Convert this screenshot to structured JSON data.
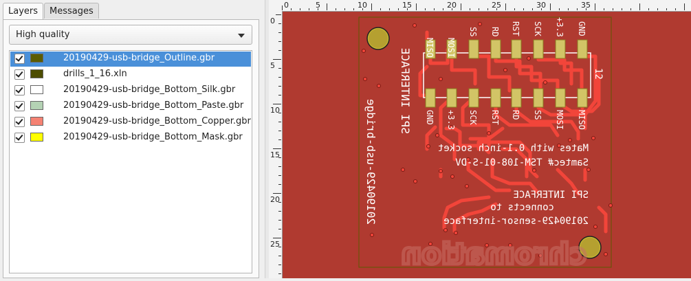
{
  "tabs": [
    {
      "label": "Layers",
      "active": true
    },
    {
      "label": "Messages",
      "active": false
    }
  ],
  "quality": {
    "selected": "High quality"
  },
  "layers": [
    {
      "name": "20190429-usb-bridge_Outline.gbr",
      "color": "#5b5b00",
      "checked": true,
      "selected": true
    },
    {
      "name": "drills_1_16.xln",
      "color": "#4d4d00",
      "checked": true,
      "selected": false
    },
    {
      "name": "20190429-usb-bridge_Bottom_Silk.gbr",
      "color": "#ffffff",
      "checked": true,
      "selected": false
    },
    {
      "name": "20190429-usb-bridge_Bottom_Paste.gbr",
      "color": "#b4d2b4",
      "checked": true,
      "selected": false
    },
    {
      "name": "20190429-usb-bridge_Bottom_Copper.gbr",
      "color": "#f58273",
      "checked": true,
      "selected": false
    },
    {
      "name": "20190429-usb-bridge_Bottom_Mask.gbr",
      "color": "#ffff00",
      "checked": true,
      "selected": false
    }
  ],
  "ruler": {
    "top_labels": [
      "0",
      "5",
      "10",
      "15",
      "20",
      "25",
      "30",
      "35"
    ],
    "left_labels": [
      "0",
      "5",
      "10",
      "15",
      "20",
      "25"
    ]
  },
  "board": {
    "pins_top": [
      "MISO",
      "MOSI",
      "SS",
      "RD",
      "RST",
      "SCK",
      "+3.3",
      "GND"
    ],
    "pins_bottom": [
      "GND",
      "+3.3",
      "SCK",
      "RST",
      "RD",
      "SS",
      "MOSI",
      "MISO"
    ],
    "title_vertical": "SPI INTERFACE",
    "date_vertical": "20190429-usb-bridge",
    "pin_count": "12",
    "notes": [
      "Mates with 0.1-inch socket",
      "Samtec# TSM-108-01-S-DV",
      "SPI INTERFACE",
      "connects to",
      "20190429-sensor-interface"
    ],
    "logo": "chromation",
    "colors": {
      "board": "#b03a30",
      "copper": "#f2453a",
      "pad": "#d2c466",
      "silk": "#ffffff",
      "outline": "#5b5b00"
    }
  }
}
